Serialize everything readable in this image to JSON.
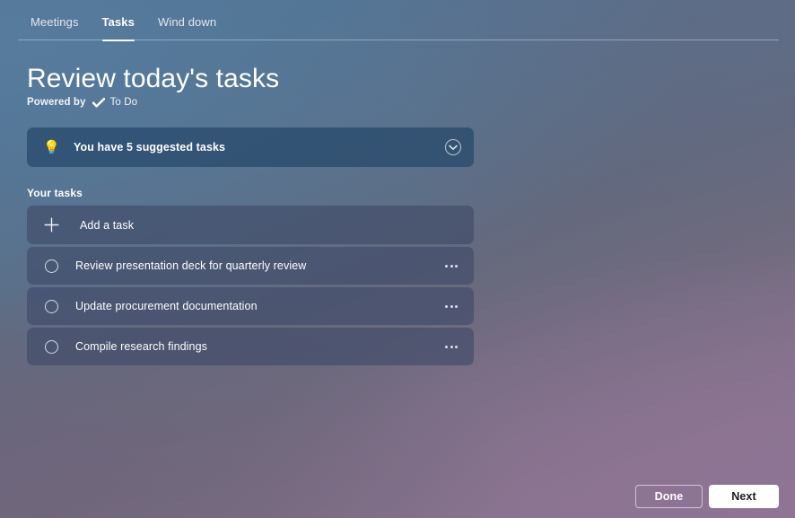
{
  "theme": {
    "background_top_left": "#4f7194",
    "background_bottom_right": "#8a7590",
    "card_fill": "#4a5472",
    "banner_fill": "#3d5873",
    "accent_text": "#ffffff",
    "primary_button_fill": "#ffffff",
    "primary_button_text": "#1b1b20"
  },
  "tabs": [
    {
      "label": "Meetings",
      "active": false
    },
    {
      "label": "Tasks",
      "active": true
    },
    {
      "label": "Wind down",
      "active": false
    }
  ],
  "header": {
    "title": "Review today's tasks",
    "powered_by_prefix": "Powered by",
    "powered_by_product": "To Do",
    "powered_by_icon": "check-mark-icon"
  },
  "suggested_banner": {
    "icon": "lightbulb-icon",
    "text": "You have 5 suggested tasks",
    "suggested_count": 5,
    "expand_icon": "chevron-down-circle-icon"
  },
  "your_tasks": {
    "section_label": "Your tasks",
    "add_row": {
      "icon": "plus-icon",
      "label": "Add a task"
    },
    "items": [
      {
        "title": "Review presentation deck for quarterly review",
        "checkbox_icon": "circle-unchecked-icon",
        "more_icon": "more-options-icon"
      },
      {
        "title": "Update procurement documentation",
        "checkbox_icon": "circle-unchecked-icon",
        "more_icon": "more-options-icon"
      },
      {
        "title": "Compile research findings",
        "checkbox_icon": "circle-unchecked-icon",
        "more_icon": "more-options-icon"
      }
    ]
  },
  "footer": {
    "done_label": "Done",
    "next_label": "Next"
  }
}
